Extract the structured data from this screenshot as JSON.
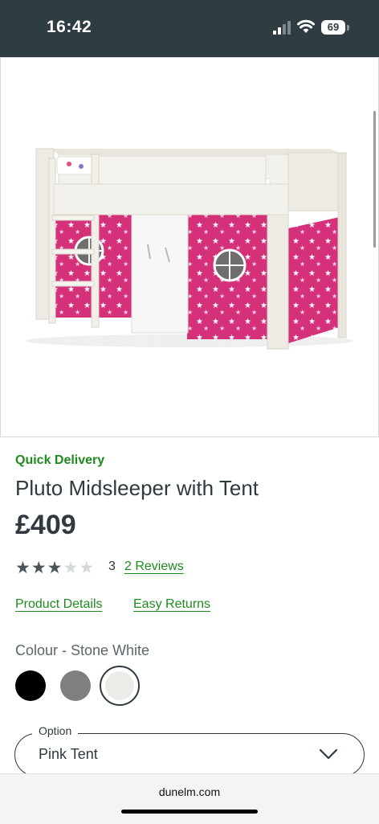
{
  "status_bar": {
    "time": "16:42",
    "battery": "69"
  },
  "product": {
    "delivery_badge": "Quick Delivery",
    "title": "Pluto Midsleeper with Tent",
    "price": "£409",
    "rating": {
      "stars_filled": 3,
      "stars_total": 5,
      "count": "3",
      "reviews_link": "2 Reviews"
    },
    "links": {
      "details": "Product Details",
      "returns": "Easy Returns"
    },
    "colour_label": "Colour - Stone White",
    "swatches": [
      {
        "name": "Black",
        "color": "#000000"
      },
      {
        "name": "Grey",
        "color": "#7f7f7f"
      },
      {
        "name": "Stone White",
        "color": "#ecebe7",
        "selected": true
      }
    ],
    "option": {
      "legend": "Option",
      "value": "Pink Tent"
    }
  },
  "browser": {
    "url": "dunelm.com"
  },
  "colors": {
    "accent_green": "#1e8a1e",
    "status_bar_bg": "#2f3d43",
    "tent_pink": "#d4317a"
  }
}
